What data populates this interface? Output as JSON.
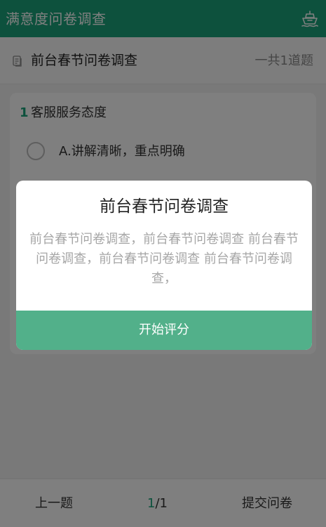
{
  "app_header": {
    "title": "满意度问卷调查",
    "icon": "ship-icon",
    "accent_color": "#1aa37b"
  },
  "survey": {
    "name": "前台春节问卷调查",
    "icon": "document-icon",
    "count_text": "一共1道题"
  },
  "question": {
    "number": "1",
    "title": "客服服务态度",
    "options": [
      {
        "label": "A.讲解清晰，重点明确",
        "selected": false
      }
    ]
  },
  "bottom_nav": {
    "prev_label": "上一题",
    "current_page": "1",
    "total_pages": "/1",
    "submit_label": "提交问卷"
  },
  "modal": {
    "title": "前台春节问卷调查",
    "description": "前台春节问卷调查，前台春节问卷调查 前台春节问卷调查，前台春节问卷调查 前台春节问卷调查，",
    "start_label": "开始评分",
    "button_color": "#52b08a"
  }
}
